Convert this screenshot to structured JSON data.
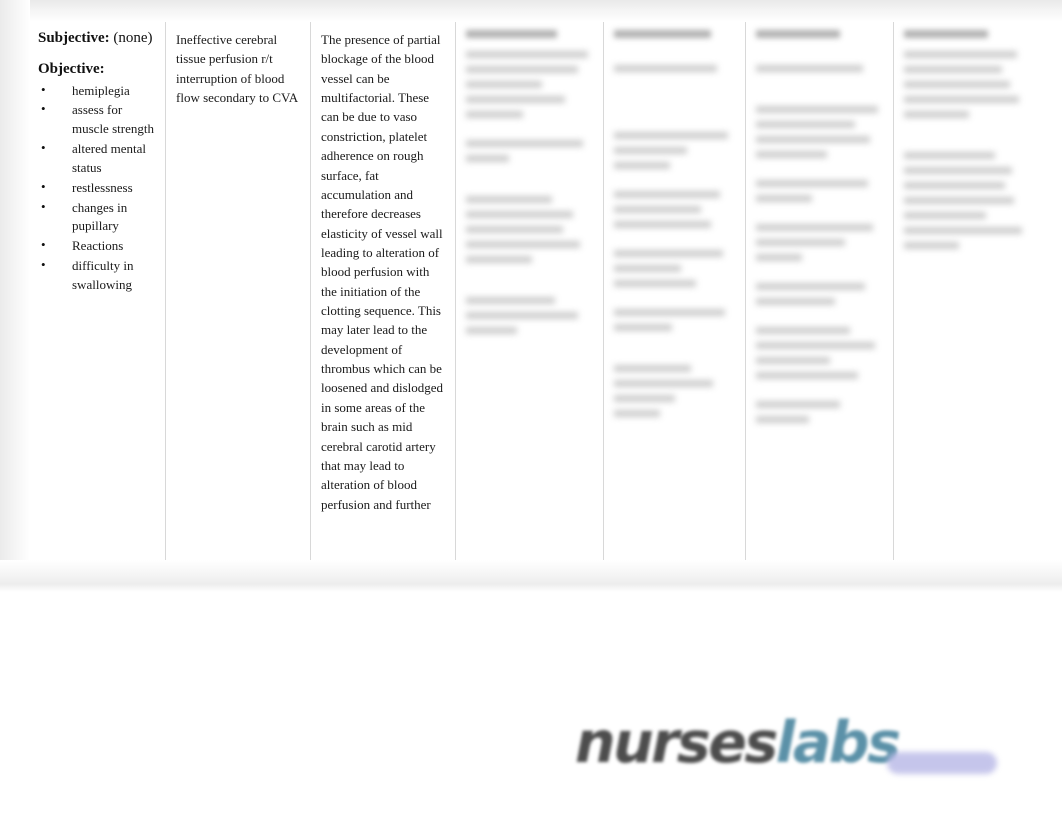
{
  "document": {
    "type": "nursing-care-plan-table",
    "background_color": "#ffffff"
  },
  "table": {
    "columns": [
      {
        "key": "assessment",
        "subjective_label": "Subjective:",
        "subjective_value": "(none)",
        "objective_label": "Objective:",
        "objective_items": [
          "hemiplegia",
          "assess for muscle strength",
          "altered mental status",
          "restlessness",
          "changes in pupillary",
          "Reactions",
          "difficulty in swallowing"
        ]
      },
      {
        "key": "diagnosis",
        "text": "Ineffective cerebral tissue perfusion r/t interruption of blood flow secondary to CVA"
      },
      {
        "key": "inference",
        "text": "The presence of partial blockage of the blood vessel can be multifactorial. These can be due to vaso constriction, platelet adherence on rough surface, fat accumulation and therefore decreases elasticity of vessel wall leading to alteration of blood perfusion with the initiation of the clotting sequence. This may later lead to the development of thrombus which can be loosened and dislodged in some areas of the brain such as mid cerebral carotid artery that may lead to alteration of blood perfusion and further"
      },
      {
        "key": "goals",
        "text": ""
      },
      {
        "key": "intervention",
        "text": ""
      },
      {
        "key": "rationale",
        "text": ""
      },
      {
        "key": "evaluation",
        "text": ""
      }
    ],
    "border_color": "#d8d8d8"
  },
  "watermark": {
    "brand_primary": "nurses",
    "brand_secondary": "labs",
    "primary_color": "#4d4d4d",
    "secondary_color": "#5b91a8",
    "bar_color": "#bcbce8"
  }
}
